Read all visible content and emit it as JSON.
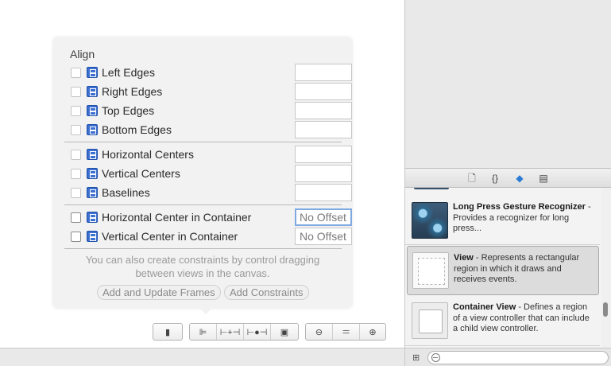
{
  "align_popover": {
    "title": "Align",
    "rows": [
      {
        "label": "Left Edges",
        "value": ""
      },
      {
        "label": "Right Edges",
        "value": ""
      },
      {
        "label": "Top Edges",
        "value": ""
      },
      {
        "label": "Bottom Edges",
        "value": ""
      },
      {
        "label": "Horizontal Centers",
        "value": ""
      },
      {
        "label": "Vertical Centers",
        "value": ""
      },
      {
        "label": "Baselines",
        "value": ""
      },
      {
        "label": "Horizontal Center in Container",
        "value": "No Offset"
      },
      {
        "label": "Vertical Center in Container",
        "value": "No Offset"
      }
    ],
    "hint": "You can also create constraints by control dragging between views in the canvas.",
    "add_update_frames_label": "Add and Update Frames",
    "add_constraints_label": "Add Constraints"
  },
  "canvas_toolbar": {
    "simulated_metrics_icon": "phone-icon",
    "align_icon": "align-icon",
    "pin_icon": "pin-icon",
    "resolve_icon": "resolve-issues-icon",
    "resize_icon": "resizing-behavior-icon",
    "zoom_out_icon": "zoom-out-icon",
    "zoom_actual_icon": "zoom-actual-icon",
    "zoom_in_icon": "zoom-in-icon"
  },
  "library": {
    "tabs": [
      "file-template-icon",
      "code-snippet-icon",
      "object-library-icon",
      "media-library-icon"
    ],
    "items": [
      {
        "name": "Long Press Gesture Recognizer",
        "desc": " - Provides a recognizer for long press..."
      },
      {
        "name": "View",
        "desc": " - Represents a rectangular region in which it draws and receives events."
      },
      {
        "name": "Container View",
        "desc": " - Defines a region of a view controller that can include a child view controller."
      }
    ],
    "filter_placeholder": ""
  },
  "colors": {
    "accent": "#3b6fd0",
    "focus_ring": "#7ea9e1",
    "popover_bg": "#f2f2f2"
  }
}
